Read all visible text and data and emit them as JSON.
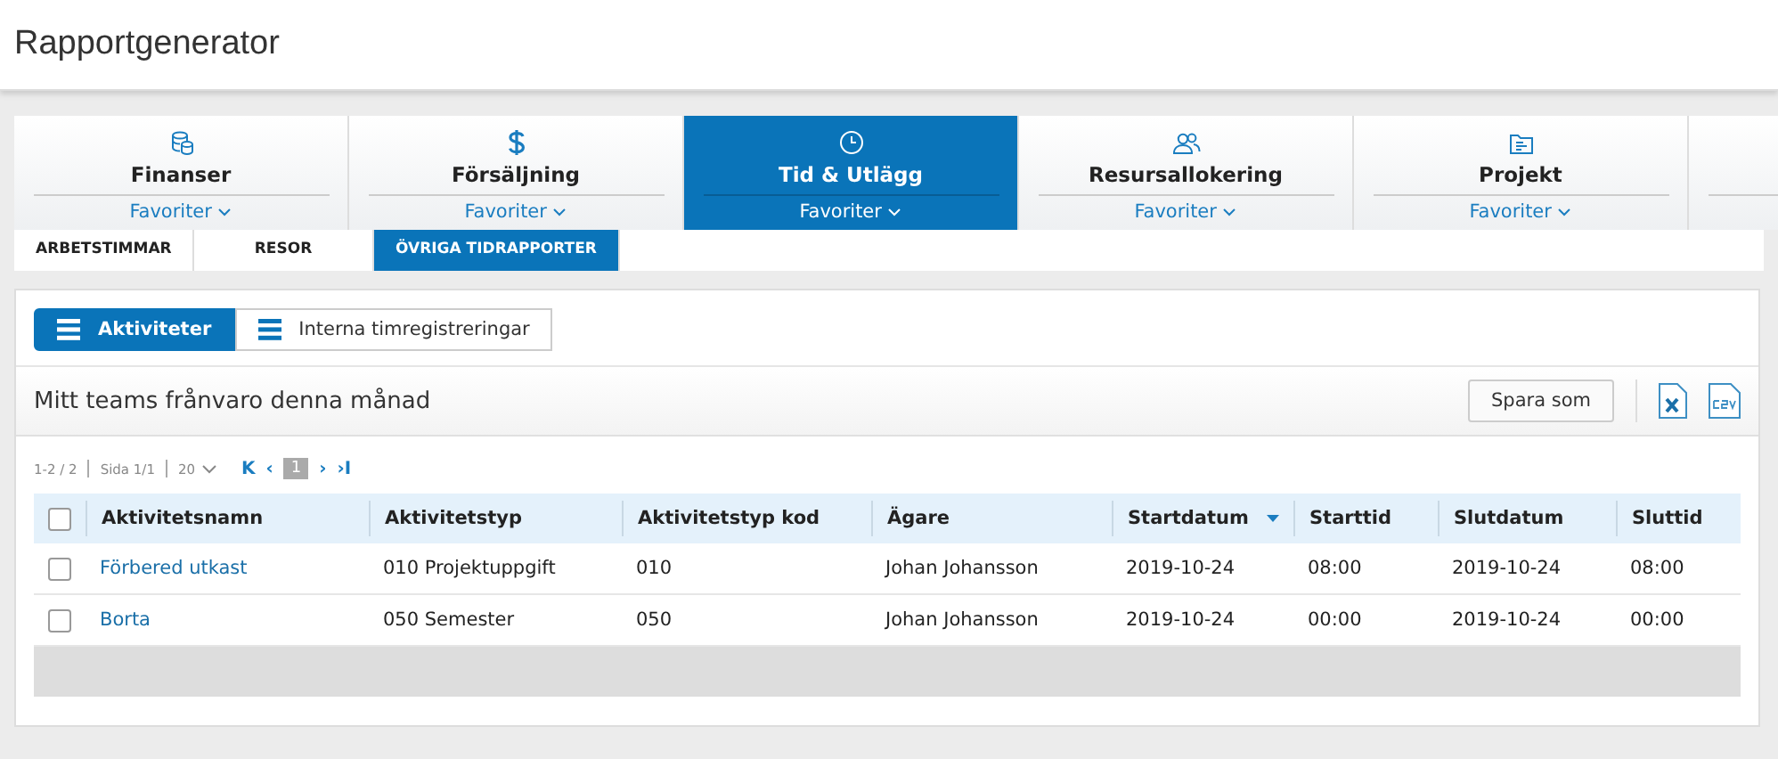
{
  "header": {
    "title": "Rapportgenerator"
  },
  "modules": [
    {
      "kind": "finance",
      "label": "Finanser",
      "favorites": "Favoriter",
      "selected": false
    },
    {
      "kind": "sales",
      "label": "Försäljning",
      "favorites": "Favoriter",
      "selected": false
    },
    {
      "kind": "time",
      "label": "Tid & Utlägg",
      "favorites": "Favoriter",
      "selected": true
    },
    {
      "kind": "resources",
      "label": "Resursallokering",
      "favorites": "Favoriter",
      "selected": false
    },
    {
      "kind": "project",
      "label": "Projekt",
      "favorites": "Favoriter",
      "selected": false
    },
    {
      "kind": "blank",
      "selected": false
    }
  ],
  "subtabs": [
    {
      "label": "ARBETSTIMMAR",
      "selected": false
    },
    {
      "label": "RESOR",
      "selected": false
    },
    {
      "label": "ÖVRIGA TIDRAPPORTER",
      "selected": true
    }
  ],
  "views": [
    {
      "label": "Aktiviteter",
      "selected": true
    },
    {
      "label": "Interna timregistreringar",
      "selected": false
    }
  ],
  "report": {
    "title": "Mitt teams frånvaro denna månad",
    "save_button": "Spara som"
  },
  "pager": {
    "range": "1-2 / 2",
    "page": "Sida 1/1",
    "page_size": "20",
    "first": "K",
    "prev": "‹",
    "current": "1",
    "next": "›",
    "last": "›I"
  },
  "table": {
    "all_checked": false,
    "columns": [
      {
        "label": "Aktivitetsnamn",
        "sorted": false
      },
      {
        "label": "Aktivitetstyp",
        "sorted": false
      },
      {
        "label": "Aktivitetstyp kod",
        "sorted": false
      },
      {
        "label": "Ägare",
        "sorted": false
      },
      {
        "label": "Startdatum",
        "sorted": true
      },
      {
        "label": "Starttid",
        "sorted": false
      },
      {
        "label": "Slutdatum",
        "sorted": false
      },
      {
        "label": "Sluttid",
        "sorted": false
      }
    ],
    "rows": [
      {
        "checked": false,
        "cells": [
          "Förbered utkast",
          "010 Projektuppgift",
          "010",
          "Johan Johansson",
          "2019-10-24",
          "08:00",
          "2019-10-24",
          "08:00"
        ]
      },
      {
        "checked": false,
        "cells": [
          "Borta",
          "050 Semester",
          "050",
          "Johan Johansson",
          "2019-10-24",
          "00:00",
          "2019-10-24",
          "00:00"
        ]
      }
    ]
  }
}
